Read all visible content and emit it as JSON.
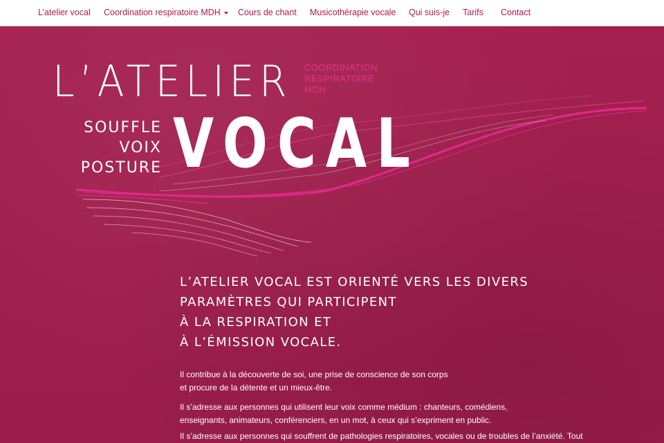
{
  "nav": {
    "items": [
      {
        "label": "L’atelier vocal"
      },
      {
        "label": "Coordination respiratoire MDH"
      },
      {
        "label": "Cours de chant"
      },
      {
        "label": "Musicothérapie vocale"
      },
      {
        "label": "Qui suis-je"
      },
      {
        "label": "Tarifs"
      },
      {
        "label": "Contact"
      }
    ]
  },
  "logo": {
    "atelier": "L’ATELIER",
    "vocal": "VOCAL",
    "side": [
      "COORDINATION",
      "RESPIRATOIRE",
      "MDH"
    ],
    "words": [
      "SOUFFLE",
      "VOIX",
      "POSTURE"
    ]
  },
  "heading": {
    "lines": [
      "L’ATELIER VOCAL EST ORIENTÉ VERS LES DIVERS",
      "PARAMÈTRES QUI PARTICIPENT",
      "À LA RESPIRATION ET",
      "À L’ÉMISSION VOCALE."
    ]
  },
  "paragraphs": [
    "Il contribue à la découverte de soi, une prise de conscience de son corps et procure de la détente et un mieux-être.",
    "Il s’adresse aux personnes qui utilisent leur voix comme médium : chanteurs, comédiens, enseignants, animateurs, conférenciers, en un mot, à ceux qui s’expriment en public.",
    "Il s’adresse aux personnes qui souffrent de pathologies respiratoires, vocales ou de troubles de l’anxiété. Tout"
  ],
  "colors": {
    "background": "#9e1f4c",
    "nav_text": "#b0174f",
    "accent_pink": "#e5338a",
    "text": "#ffffff"
  }
}
